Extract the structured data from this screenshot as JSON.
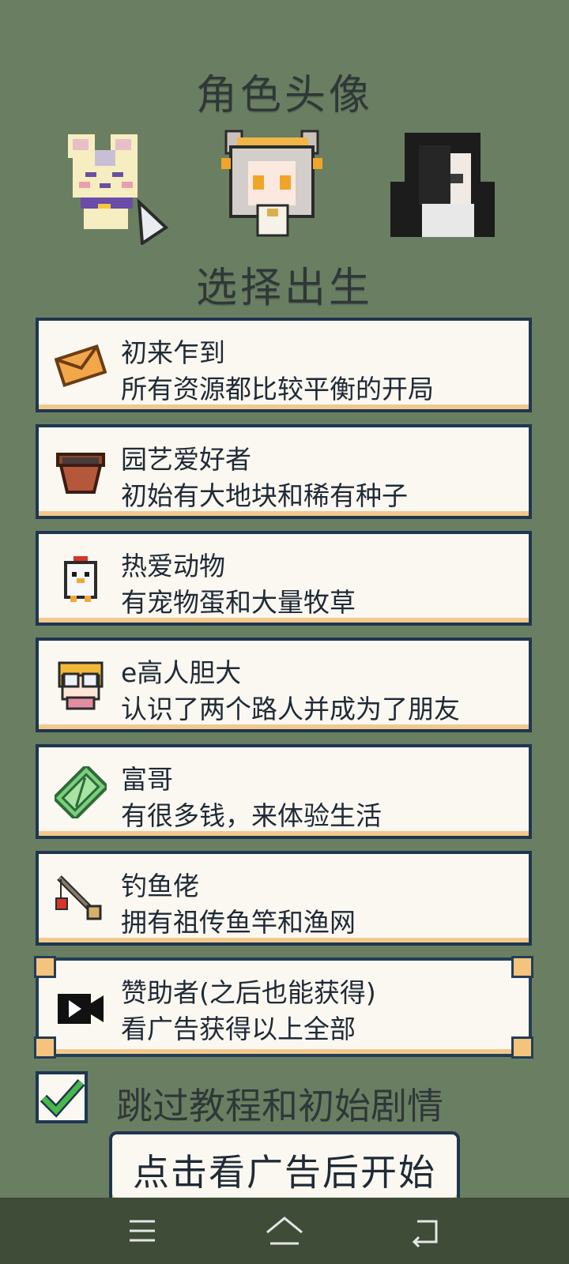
{
  "avatar_section": {
    "title": "角色头像",
    "avatars": [
      {
        "name": "bear-avatar"
      },
      {
        "name": "white-hair-girl-avatar"
      },
      {
        "name": "black-hair-girl-avatar"
      }
    ]
  },
  "birth_section": {
    "title": "选择出生",
    "options": [
      {
        "title": "初来乍到",
        "desc": "所有资源都比较平衡的开局",
        "icon": "envelope-icon"
      },
      {
        "title": "园艺爱好者",
        "desc": "初始有大地块和稀有种子",
        "icon": "flower-pot-icon"
      },
      {
        "title": "热爱动物",
        "desc": "有宠物蛋和大量牧草",
        "icon": "chicken-icon"
      },
      {
        "title": "e高人胆大",
        "desc": "认识了两个路人并成为了朋友",
        "icon": "character-face-icon"
      },
      {
        "title": "富哥",
        "desc": "有很多钱，来体验生活",
        "icon": "money-icon"
      },
      {
        "title": "钓鱼佬",
        "desc": "拥有祖传鱼竿和渔网",
        "icon": "fishing-rod-icon"
      },
      {
        "title": "赞助者(之后也能获得)",
        "desc": "看广告获得以上全部",
        "icon": "video-ad-icon"
      }
    ]
  },
  "skip_tutorial": {
    "label": "跳过教程和初始剧情",
    "checked": true
  },
  "start_button": {
    "label": "点击看广告后开始"
  },
  "colors": {
    "background": "#6a7f62",
    "card": "#fbf8f1",
    "border": "#1e3650",
    "accent": "#f2c98c"
  }
}
